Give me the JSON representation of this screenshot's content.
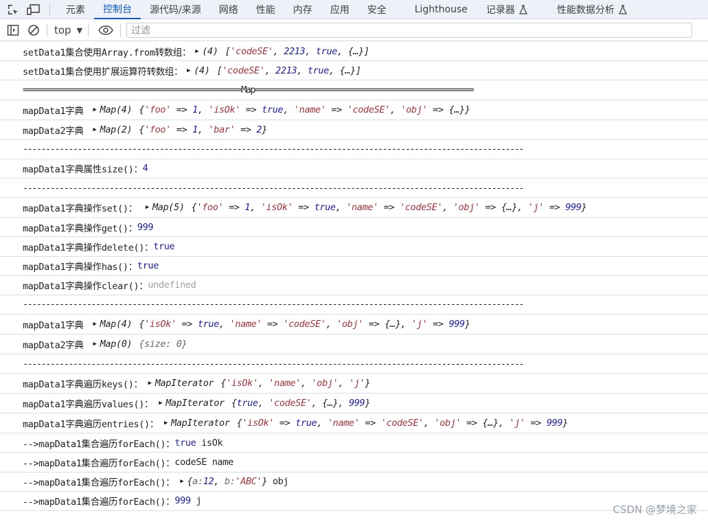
{
  "tabs": [
    "元素",
    "控制台",
    "源代码/来源",
    "网络",
    "性能",
    "内存",
    "应用",
    "安全",
    "Lighthouse",
    "记录器",
    "性能数据分析"
  ],
  "toolbar": {
    "context": "top",
    "filter_placeholder": "过滤"
  },
  "log": {
    "l1_label": "setData1集合使用Array.from转数组：",
    "l1_count": "(4)",
    "l1_s": "'codeSE'",
    "l1_n": "2213",
    "l1_b": "true",
    "l1_o": "{…}",
    "l2_label": "setData1集合使用扩展运算符转数组：",
    "l2_count": "(4)",
    "l2_s": "'codeSE'",
    "l2_n": "2213",
    "l2_b": "true",
    "l2_o": "{…}",
    "sep_map": "================================================Map================================================",
    "l4_label": "mapData1字典",
    "l4_type": "Map(4)",
    "l5_label": "mapData2字典",
    "l5_type": "Map(2)",
    "sep_dash": "--------------------------------------------------------------------------------------------------------------",
    "l7_label": "mapData1字典属性size()：",
    "l7_value": "4",
    "l9_label": "mapData1字典操作set()：",
    "l9_type": "Map(5)",
    "l10_label": "mapData1字典操作get()：",
    "l10_value": "999",
    "l11_label": "mapData1字典操作delete()：",
    "l11_value": "true",
    "l12_label": "mapData1字典操作has()：",
    "l12_value": "true",
    "l13_label": "mapData1字典操作clear()：",
    "l13_value": "undefined",
    "l15_label": "mapData1字典",
    "l15_type": "Map(4)",
    "l16_label": "mapData2字典",
    "l16_type": "Map(0)",
    "l16_size": "{size: 0}",
    "l18_label": "mapData1字典遍历keys()：",
    "l18_type": "MapIterator",
    "l19_label": "mapData1字典遍历values()：",
    "l19_type": "MapIterator",
    "l20_label": "mapData1字典遍历entries()：",
    "l20_type": "MapIterator",
    "l21_label": "-->mapData1集合遍历forEach()：",
    "l21_v1": "true",
    "l21_v2": "isOk",
    "l22_label": "-->mapData1集合遍历forEach()：",
    "l22_v1": "codeSE",
    "l22_v2": "name",
    "l23_label": "-->mapData1集合遍历forEach()：",
    "l23_obj_a": "a: ",
    "l23_obj_an": "12",
    "l23_obj_b": "b: ",
    "l23_obj_bs": "'ABC'",
    "l23_v2": "obj",
    "l24_label": "-->mapData1集合遍历forEach()：",
    "l24_v1": "999",
    "l24_v2": "j"
  },
  "watermark": "CSDN @梦境之家"
}
